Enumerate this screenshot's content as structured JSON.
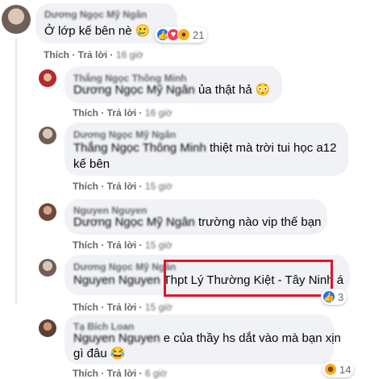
{
  "comments": [
    {
      "author": "Dương Ngọc Mỹ Ngân",
      "text": "Ở lớp kế bên nè 🥲",
      "like": "Thích",
      "reply": "Trả lời",
      "time": "16 giờ",
      "reactions": {
        "count": "21",
        "icons": [
          "like-icon",
          "love-icon",
          "wow-icon"
        ]
      },
      "avatar_color": "#8c7d73"
    },
    {
      "author": "Thắng Ngọc Thông Minh",
      "mention": "Dương Ngọc Mỹ Ngân",
      "text": "ủa thật hả 😳",
      "like": "Thích",
      "reply": "Trả lời",
      "time": "16 giờ",
      "avatar_color": "#b32a2a"
    },
    {
      "author": "Dương Ngọc Mỹ Ngân",
      "mention": "Thắng Ngọc Thông Minh",
      "text_line1": "thiệt mà trời tui học a12",
      "text_line2": "kế bên",
      "like": "Thích",
      "reply": "Trả lời",
      "time": "15 giờ",
      "avatar_color": "#8c7d73"
    },
    {
      "author": "Nguyen Nguyen",
      "mention": "Dương Ngọc Mỹ Ngân",
      "text": "trường nào vip thế bạn",
      "like": "Thích",
      "reply": "Trả lời",
      "time": "15 giờ",
      "avatar_color": "#6b4a3a"
    },
    {
      "author": "Dương Ngọc Mỹ Ngân",
      "mention": "Nguyen Nguyen",
      "text": "Thpt Lý Thường Kiệt - Tây Ninh á",
      "like": "Thích",
      "reply": "Trả lời",
      "time": "15 giờ",
      "reactions": {
        "count": "3",
        "icons": [
          "like-icon"
        ]
      },
      "avatar_color": "#8c7d73"
    },
    {
      "author": "Tạ Bích Loan",
      "mention": "Nguyen Nguyen",
      "text_line1": "e của thầy hs dắt vào mà bạn xịn",
      "text_line2": "gì đâu 😂",
      "like": "Thích",
      "reply": "Trả lời",
      "time": "6 giờ",
      "reactions": {
        "count": "14",
        "icons": [
          "haha-icon"
        ]
      },
      "avatar_color": "#5a4030"
    }
  ],
  "colors": {
    "highlight": "#e0162b",
    "like_blue": "#1877f2",
    "love_red": "#f33e58",
    "yellow": "#f7b125"
  }
}
